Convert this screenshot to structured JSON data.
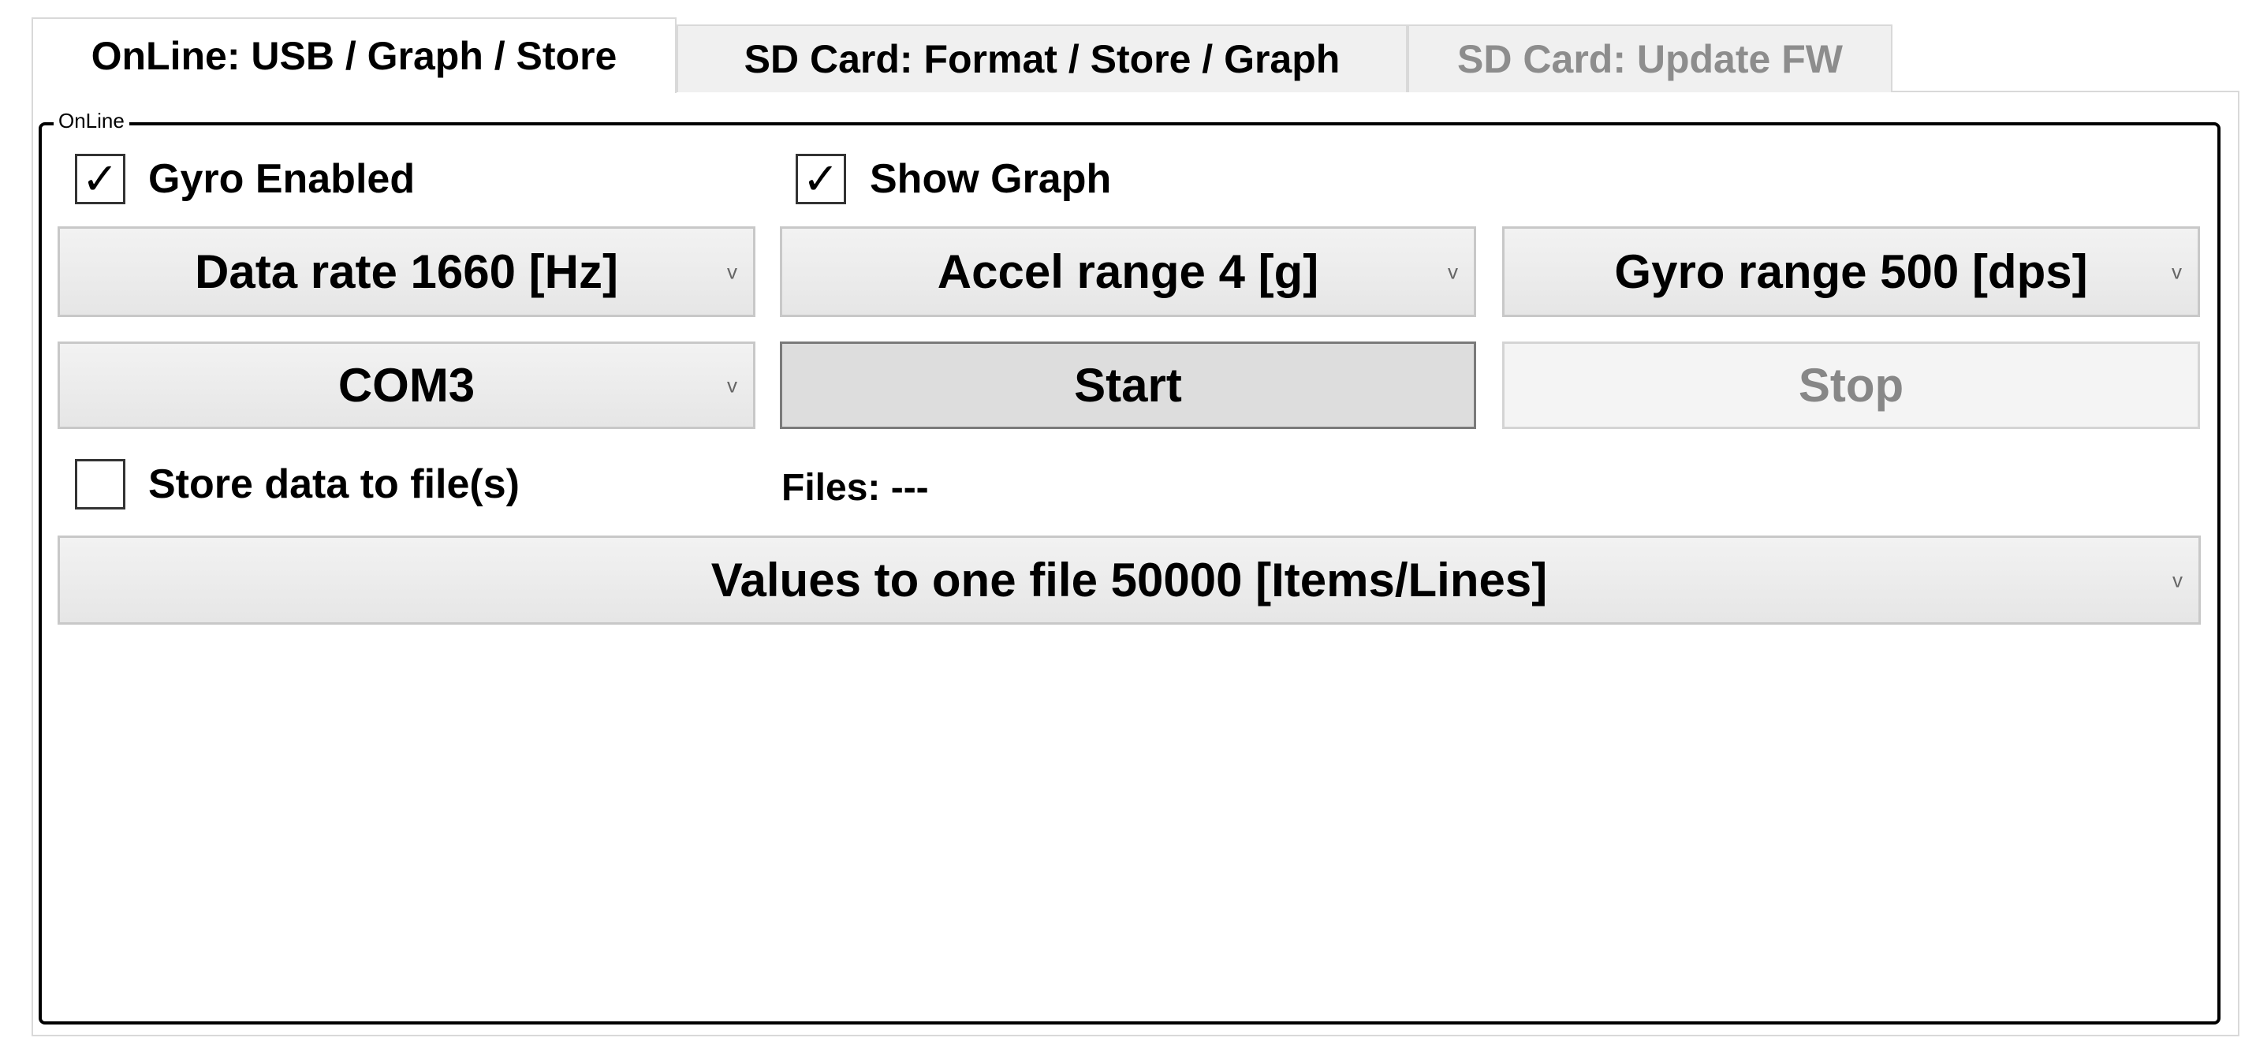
{
  "tabs": [
    {
      "label": "OnLine: USB / Graph / Store",
      "state": "active"
    },
    {
      "label": "SD Card: Format / Store / Graph",
      "state": "normal"
    },
    {
      "label": "SD Card: Update FW",
      "state": "disabled"
    }
  ],
  "group": {
    "label": "OnLine"
  },
  "checkboxes": {
    "gyro_enabled": {
      "label": "Gyro Enabled",
      "checked": true
    },
    "show_graph": {
      "label": "Show Graph",
      "checked": true
    },
    "store_data": {
      "label": "Store data to file(s)",
      "checked": false
    }
  },
  "combos": {
    "data_rate": "Data rate 1660 [Hz]",
    "accel_range": "Accel range 4 [g]",
    "gyro_range": "Gyro range 500 [dps]",
    "port": "COM3",
    "values_per_file": "Values to one file 50000 [Items/Lines]"
  },
  "buttons": {
    "start": "Start",
    "stop": "Stop"
  },
  "files": {
    "label": "Files: ---"
  },
  "icons": {
    "check": "✓",
    "chevron": "v"
  }
}
